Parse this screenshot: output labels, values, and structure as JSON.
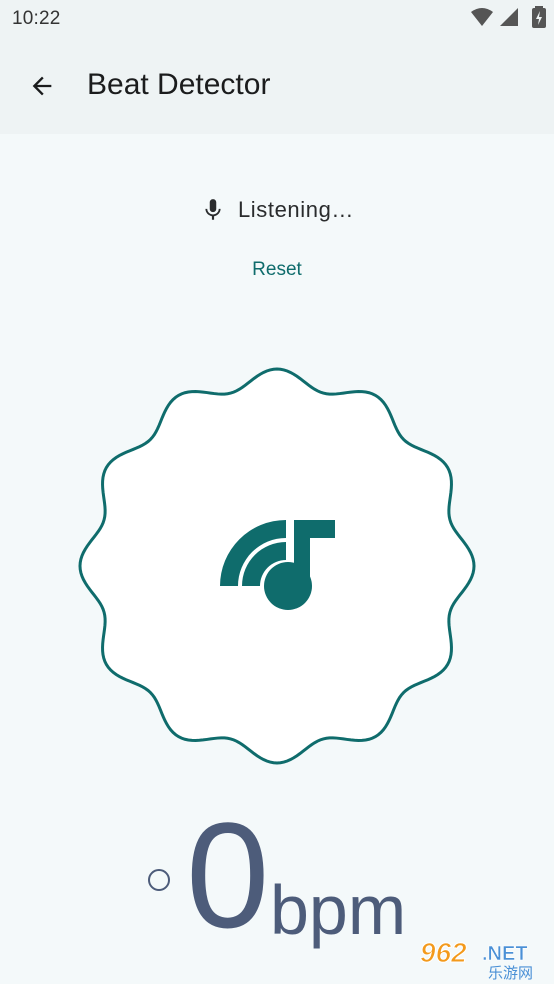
{
  "status_bar": {
    "time": "10:22",
    "icons": [
      "wifi-icon",
      "signal-icon",
      "battery-icon"
    ]
  },
  "app_bar": {
    "back_icon": "arrow-back-icon",
    "title": "Beat Detector"
  },
  "listening": {
    "icon": "microphone-icon",
    "text": "Listening…"
  },
  "reset_label": "Reset",
  "detector": {
    "icon": "music-note-waves-icon",
    "accent_color": "#0f6c6c"
  },
  "bpm": {
    "value": "0",
    "unit": "bpm",
    "color": "#4d5c7a"
  },
  "watermark": {
    "brand": "962",
    "suffix": ".NET",
    "caption": "乐游网"
  }
}
